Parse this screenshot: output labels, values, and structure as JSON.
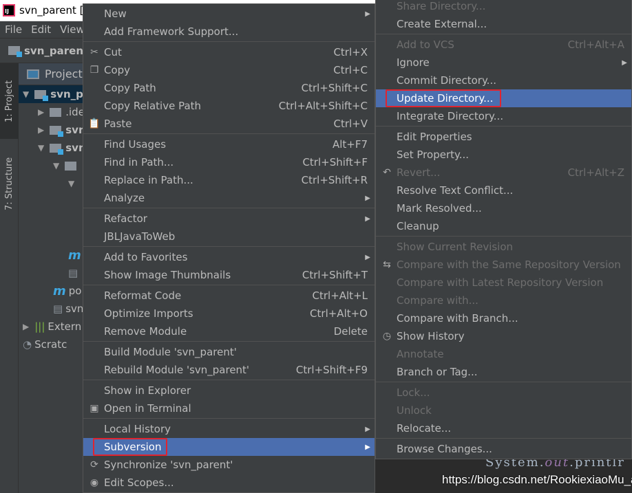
{
  "window": {
    "title": "svn_parent [F"
  },
  "menubar": [
    "File",
    "Edit",
    "View"
  ],
  "navbar": {
    "project": "svn_parent"
  },
  "toolstrip": {
    "project_tab": "1: Project",
    "structure_tab": "7: Structure"
  },
  "project_panel": {
    "header": "Project",
    "tree": [
      {
        "label": "svn_p",
        "indent": 0,
        "arrow": "down",
        "icon": "module-folder-icon",
        "bold": true
      },
      {
        "label": ".ide",
        "indent": 1,
        "arrow": "right",
        "icon": "folder-icon"
      },
      {
        "label": "svn",
        "indent": 1,
        "arrow": "right",
        "icon": "module-folder-icon",
        "bold": true
      },
      {
        "label": "svn",
        "indent": 1,
        "arrow": "down",
        "icon": "module-folder-icon",
        "bold": true
      },
      {
        "label": "",
        "indent": 2,
        "arrow": "down",
        "icon": "folder-icon"
      },
      {
        "label": "",
        "indent": 3,
        "arrow": "down",
        "icon": ""
      },
      {
        "label": "",
        "indent": 0,
        "arrow": "",
        "icon": ""
      },
      {
        "label": "",
        "indent": 0,
        "arrow": "",
        "icon": ""
      },
      {
        "label": "",
        "indent": 0,
        "arrow": "",
        "icon": ""
      },
      {
        "label": "",
        "indent": 3,
        "arrow": "",
        "icon": "maven-icon"
      },
      {
        "label": "",
        "indent": 3,
        "arrow": "",
        "icon": "file-icon"
      },
      {
        "label": "po",
        "indent": 2,
        "arrow": "",
        "icon": "maven-icon"
      },
      {
        "label": "svn",
        "indent": 2,
        "arrow": "",
        "icon": "file-icon"
      },
      {
        "label": "Extern",
        "indent": 0,
        "arrow": "right",
        "icon": "library-icon"
      },
      {
        "label": "Scratc",
        "indent": 0,
        "arrow": "",
        "icon": "scratch-icon"
      }
    ]
  },
  "context_menu": [
    {
      "label": "New",
      "arrow": true
    },
    {
      "label": "Add Framework Support..."
    },
    {
      "sep": true
    },
    {
      "label": "Cut",
      "shortcut": "Ctrl+X",
      "icon": "cut-icon"
    },
    {
      "label": "Copy",
      "shortcut": "Ctrl+C",
      "icon": "copy-icon"
    },
    {
      "label": "Copy Path",
      "shortcut": "Ctrl+Shift+C"
    },
    {
      "label": "Copy Relative Path",
      "shortcut": "Ctrl+Alt+Shift+C"
    },
    {
      "label": "Paste",
      "shortcut": "Ctrl+V",
      "icon": "paste-icon"
    },
    {
      "sep": true
    },
    {
      "label": "Find Usages",
      "shortcut": "Alt+F7"
    },
    {
      "label": "Find in Path...",
      "shortcut": "Ctrl+Shift+F"
    },
    {
      "label": "Replace in Path...",
      "shortcut": "Ctrl+Shift+R"
    },
    {
      "label": "Analyze",
      "arrow": true
    },
    {
      "sep": true
    },
    {
      "label": "Refactor",
      "arrow": true
    },
    {
      "label": "JBLJavaToWeb"
    },
    {
      "sep": true
    },
    {
      "label": "Add to Favorites",
      "arrow": true
    },
    {
      "label": "Show Image Thumbnails",
      "shortcut": "Ctrl+Shift+T"
    },
    {
      "sep": true
    },
    {
      "label": "Reformat Code",
      "shortcut": "Ctrl+Alt+L"
    },
    {
      "label": "Optimize Imports",
      "shortcut": "Ctrl+Alt+O"
    },
    {
      "label": "Remove Module",
      "shortcut": "Delete"
    },
    {
      "sep": true
    },
    {
      "label": "Build Module 'svn_parent'"
    },
    {
      "label": "Rebuild Module 'svn_parent'",
      "shortcut": "Ctrl+Shift+F9"
    },
    {
      "sep": true
    },
    {
      "label": "Show in Explorer"
    },
    {
      "label": "Open in Terminal",
      "icon": "terminal-icon"
    },
    {
      "sep": true
    },
    {
      "label": "Local History",
      "arrow": true
    },
    {
      "label": "Subversion",
      "arrow": true,
      "selected": true,
      "boxed": true
    },
    {
      "label": "Synchronize 'svn_parent'",
      "icon": "sync-icon"
    },
    {
      "label": "Edit Scopes...",
      "icon": "scope-icon"
    }
  ],
  "subversion_menu": [
    {
      "label": "Share Directory...",
      "disabled": true
    },
    {
      "label": "Create External..."
    },
    {
      "sep": true
    },
    {
      "label": "Add to VCS",
      "shortcut": "Ctrl+Alt+A",
      "disabled": true
    },
    {
      "label": "Ignore",
      "arrow": true
    },
    {
      "label": "Commit Directory..."
    },
    {
      "label": "Update Directory...",
      "selected": true,
      "boxed": true
    },
    {
      "label": "Integrate Directory..."
    },
    {
      "sep": true
    },
    {
      "label": "Edit Properties"
    },
    {
      "label": "Set Property..."
    },
    {
      "label": "Revert...",
      "shortcut": "Ctrl+Alt+Z",
      "disabled": true,
      "icon": "revert-icon"
    },
    {
      "label": "Resolve Text Conflict..."
    },
    {
      "label": "Mark Resolved..."
    },
    {
      "label": "Cleanup"
    },
    {
      "sep": true
    },
    {
      "label": "Show Current Revision",
      "disabled": true
    },
    {
      "label": "Compare with the Same Repository Version",
      "disabled": true,
      "icon": "compare-icon"
    },
    {
      "label": "Compare with Latest Repository Version",
      "disabled": true
    },
    {
      "label": "Compare with...",
      "disabled": true
    },
    {
      "label": "Compare with Branch..."
    },
    {
      "label": "Show History",
      "icon": "history-icon"
    },
    {
      "label": "Annotate",
      "disabled": true
    },
    {
      "label": "Branch or Tag..."
    },
    {
      "sep": true
    },
    {
      "label": "Lock...",
      "disabled": true
    },
    {
      "label": "Unlock",
      "disabled": true
    },
    {
      "label": "Relocate..."
    },
    {
      "sep": true
    },
    {
      "label": "Browse Changes..."
    }
  ],
  "editor": {
    "code_prefix": "System.",
    "code_field": "out",
    "code_suffix": ".printlr"
  },
  "watermark": "https://blog.csdn.net/RookiexiaoMu_a",
  "colors": {
    "selection": "#4b6eaf",
    "highlight_box": "#e0242f",
    "menu_bg": "#3c3f41"
  }
}
